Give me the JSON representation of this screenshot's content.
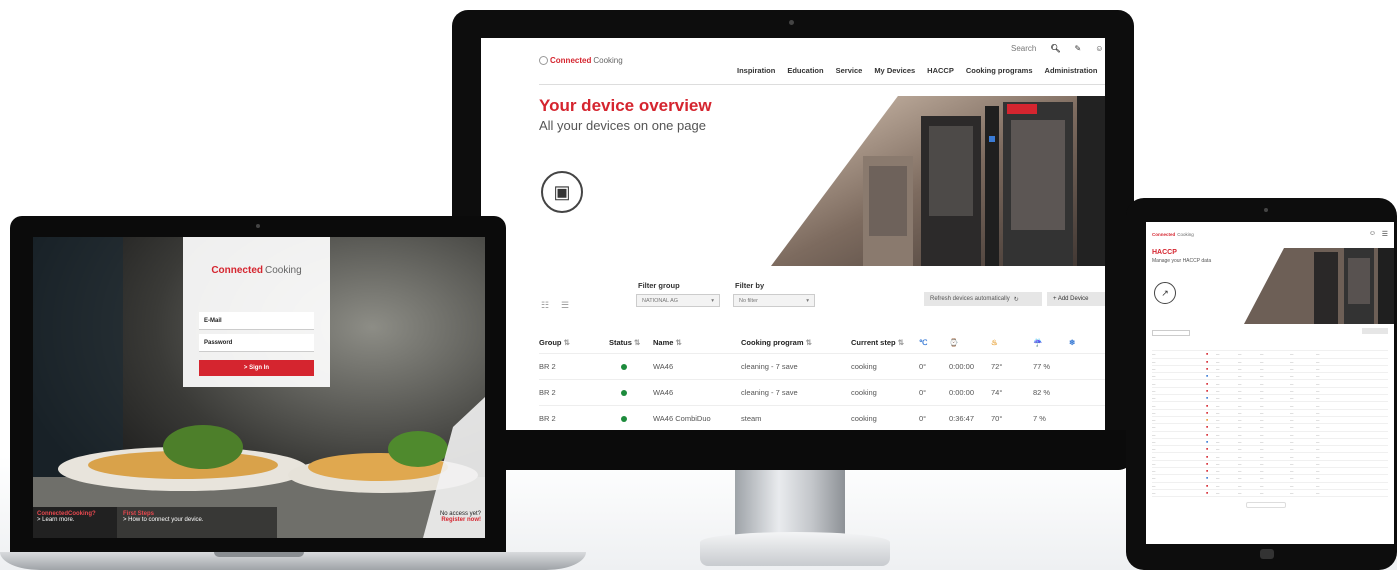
{
  "monitor": {
    "search_label": "Search",
    "logo": {
      "brand_red": "Connected",
      "brand_gray": "Cooking"
    },
    "nav": [
      "Inspiration",
      "Education",
      "Service",
      "My Devices",
      "HACCP",
      "Cooking programs",
      "Administration"
    ],
    "hero_title": "Your device overview",
    "hero_subtitle": "All your devices on one page",
    "filter_group_label": "Filter group",
    "filter_group_value": "NATIONAL AG",
    "filter_by_label": "Filter by",
    "filter_by_value": "No filter",
    "refresh_label": "Refresh devices automatically",
    "add_device_label": "+ Add Device",
    "table": {
      "headers": [
        "Group",
        "Status",
        "Name",
        "Cooking program",
        "Current step",
        "",
        "",
        "",
        "",
        ""
      ],
      "rows": [
        {
          "group": "BR 2",
          "name": "WA46",
          "program": "cleaning - 7 save",
          "step": "cooking",
          "c1": "0°",
          "c2": "0:00:00",
          "c3": "72°",
          "c4": "77 %"
        },
        {
          "group": "BR 2",
          "name": "WA46",
          "program": "cleaning - 7 save",
          "step": "cooking",
          "c1": "0°",
          "c2": "0:00:00",
          "c3": "74°",
          "c4": "82 %"
        },
        {
          "group": "BR 2",
          "name": "WA46 CombiDuo",
          "program": "steam",
          "step": "cooking",
          "c1": "0°",
          "c2": "0:36:47",
          "c3": "70°",
          "c4": "7 %"
        }
      ]
    }
  },
  "laptop": {
    "logo": {
      "brand_red": "Connected",
      "brand_gray": "Cooking"
    },
    "email_label": "E-Mail",
    "password_label": "Password",
    "signin_label": "> Sign In",
    "footer_left_title": "ConnectedCooking?",
    "footer_left_link": "> Learn more.",
    "footer_mid_title": "First Steps",
    "footer_mid_link": "> How to connect your device.",
    "footer_right_title": "No access yet?",
    "footer_right_link": "Register now!"
  },
  "tablet": {
    "logo": {
      "brand_red": "Connected",
      "brand_gray": "Cooking"
    },
    "title": "HACCP",
    "subtitle": "Manage your HACCP data"
  },
  "colors": {
    "brand_red": "#d5252f",
    "status_green": "#1d8b3c"
  }
}
